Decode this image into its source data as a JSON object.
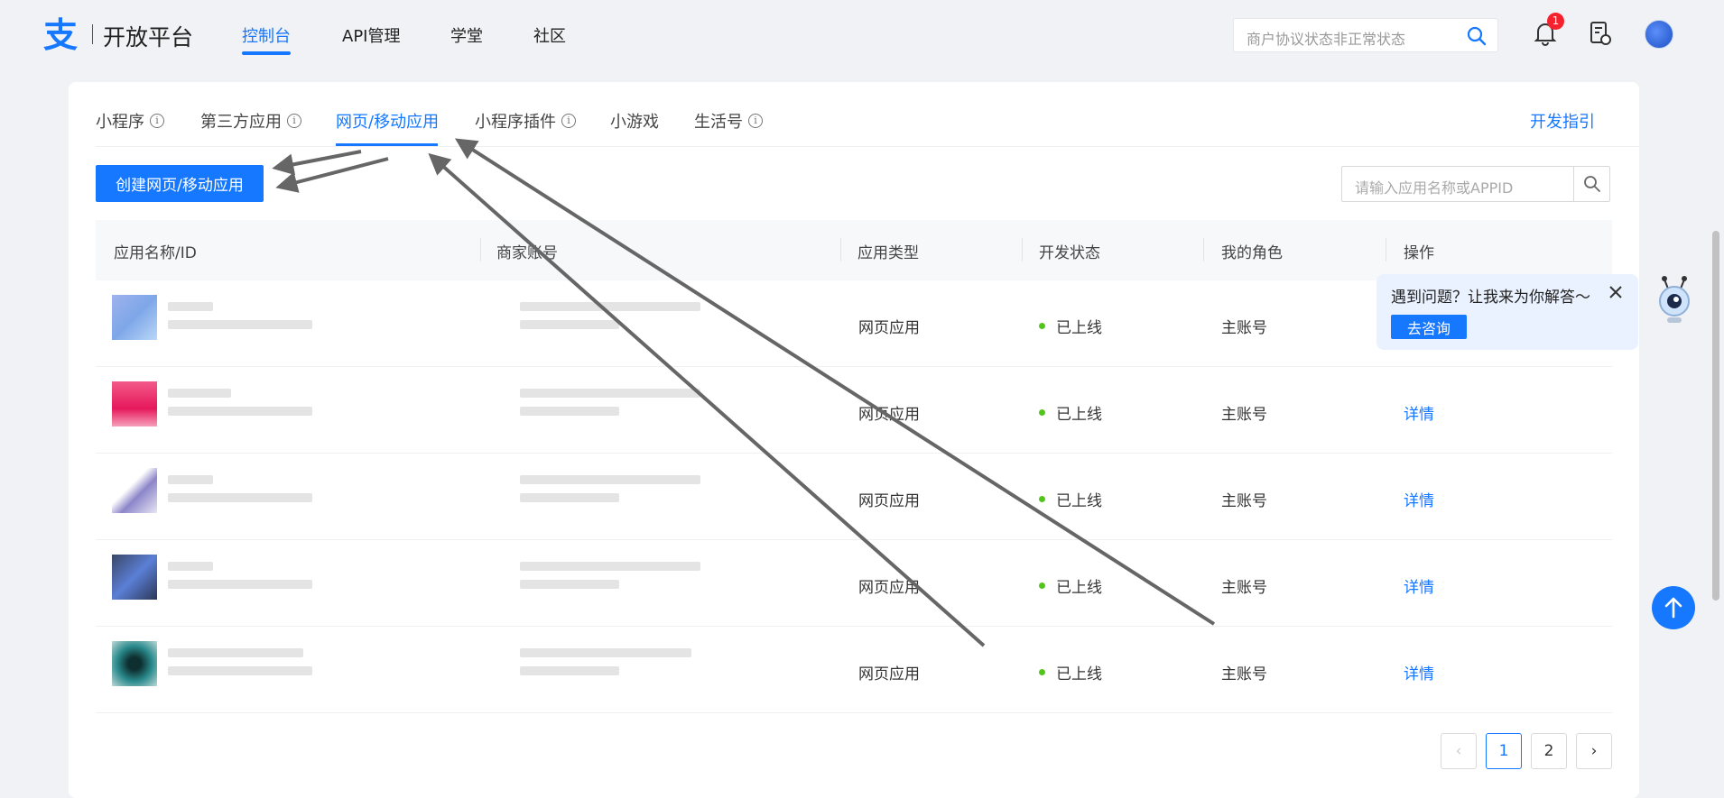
{
  "header": {
    "logo_text": "开放平台",
    "nav": [
      "控制台",
      "API管理",
      "学堂",
      "社区"
    ],
    "search_placeholder": "商户协议状态非正常状态",
    "notification_count": "1"
  },
  "tabs": [
    {
      "label": "小程序",
      "info": true
    },
    {
      "label": "第三方应用",
      "info": true
    },
    {
      "label": "网页/移动应用",
      "info": false,
      "active": true
    },
    {
      "label": "小程序插件",
      "info": true
    },
    {
      "label": "小游戏",
      "info": false
    },
    {
      "label": "生活号",
      "info": true
    }
  ],
  "guide_link": "开发指引",
  "create_button": "创建网页/移动应用",
  "app_search_placeholder": "请输入应用名称或APPID",
  "table": {
    "columns": [
      "应用名称/ID",
      "商家账号",
      "应用类型",
      "开发状态",
      "我的角色",
      "操作"
    ],
    "rows": [
      {
        "type": "网页应用",
        "status": "已上线",
        "role": "主账号",
        "action": ""
      },
      {
        "type": "网页应用",
        "status": "已上线",
        "role": "主账号",
        "action": "详情"
      },
      {
        "type": "网页应用",
        "status": "已上线",
        "role": "主账号",
        "action": "详情"
      },
      {
        "type": "网页应用",
        "status": "已上线",
        "role": "主账号",
        "action": "详情"
      },
      {
        "type": "网页应用",
        "status": "已上线",
        "role": "主账号",
        "action": "详情"
      }
    ]
  },
  "pagination": {
    "prev": "‹",
    "pages": [
      "1",
      "2"
    ],
    "current": "1",
    "next": "›"
  },
  "help": {
    "question": "遇到问题？让我来为你解答～",
    "button": "去咨询"
  },
  "colors": {
    "primary": "#1677ff",
    "online_dot": "#52c41a",
    "badge": "#f5222d"
  }
}
